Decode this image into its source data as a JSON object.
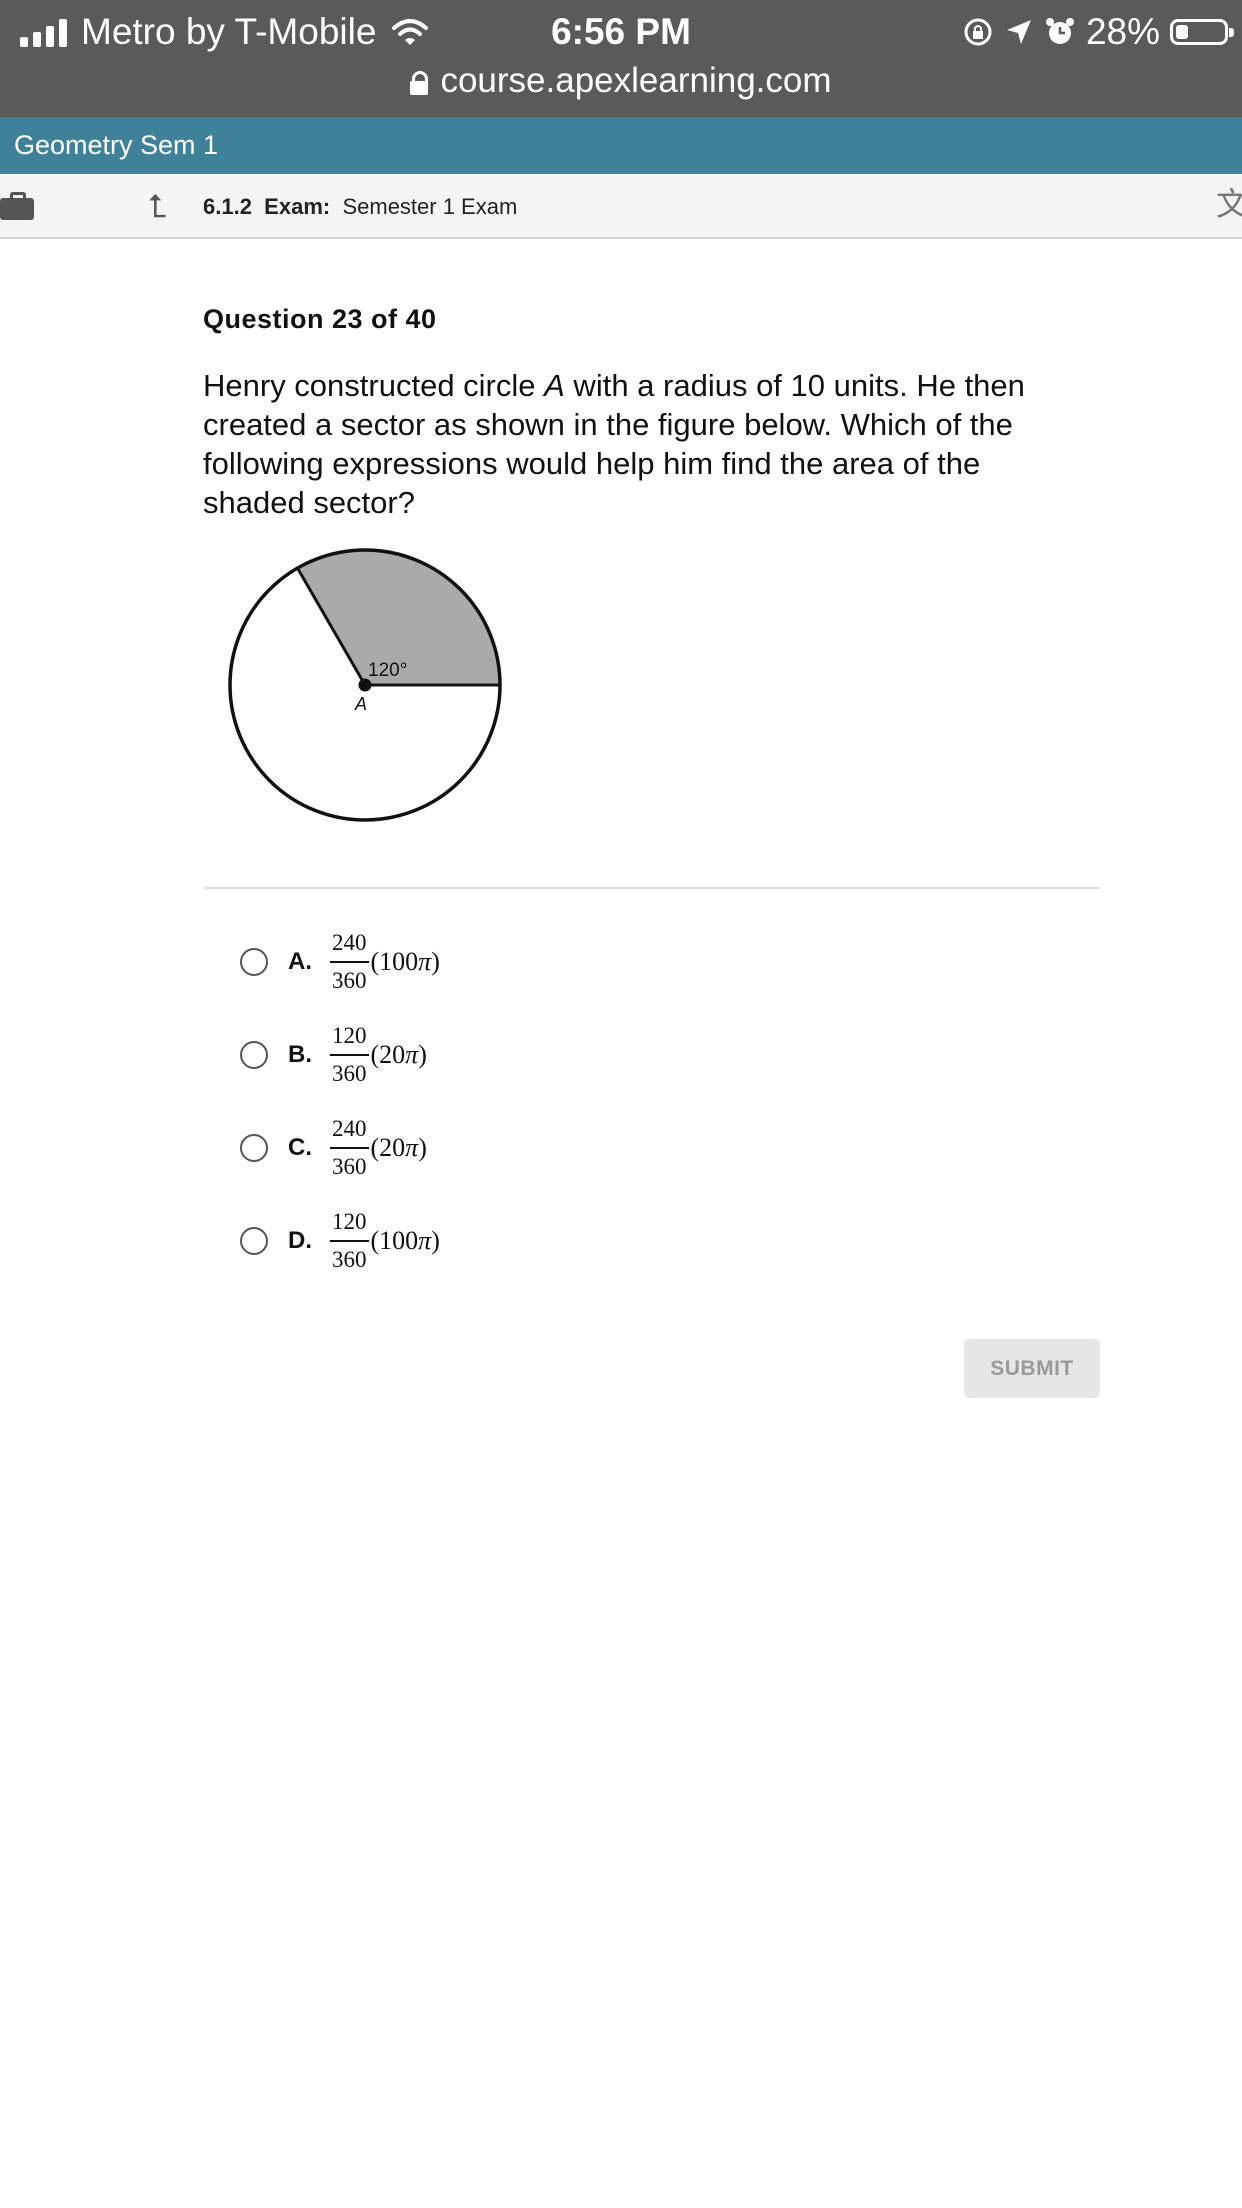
{
  "status_bar": {
    "carrier": "Metro by T-Mobile",
    "time": "6:56 PM",
    "battery_percent": "28%",
    "url": "course.apexlearning.com"
  },
  "course": {
    "title": "Geometry Sem 1"
  },
  "exam": {
    "number": "6.1.2",
    "label": "Exam:",
    "title": "Semester 1 Exam"
  },
  "question": {
    "number_text": "Question 23 of 40",
    "text_before": "Henry constructed circle ",
    "text_var": "A",
    "text_after": " with a radius of 10 units. He then created a sector as shown in the figure below. Which of the following expressions would help him find the area of the shaded sector?",
    "figure": {
      "angle_label": "120°",
      "center_label": "A"
    }
  },
  "options": [
    {
      "letter": "A.",
      "numerator": "240",
      "denominator": "360",
      "factor": "100",
      "pi": "π"
    },
    {
      "letter": "B.",
      "numerator": "120",
      "denominator": "360",
      "factor": "20",
      "pi": "π"
    },
    {
      "letter": "C.",
      "numerator": "240",
      "denominator": "360",
      "factor": "20",
      "pi": "π"
    },
    {
      "letter": "D.",
      "numerator": "120",
      "denominator": "360",
      "factor": "100",
      "pi": "π"
    }
  ],
  "submit_label": "SUBMIT",
  "icons": {
    "signal": "signal-bars-icon",
    "wifi": "wifi-icon",
    "rotation_lock": "rotation-lock-icon",
    "location": "location-arrow-icon",
    "alarm": "alarm-clock-icon",
    "battery": "battery-icon",
    "lock": "lock-icon",
    "briefcase": "briefcase-icon",
    "up": "up-arrow-icon",
    "translate": "translate-icon"
  },
  "colors": {
    "status_bar": "#5a5a5a",
    "course_bar": "#3f8198",
    "sector_fill": "#aaaaaa"
  }
}
